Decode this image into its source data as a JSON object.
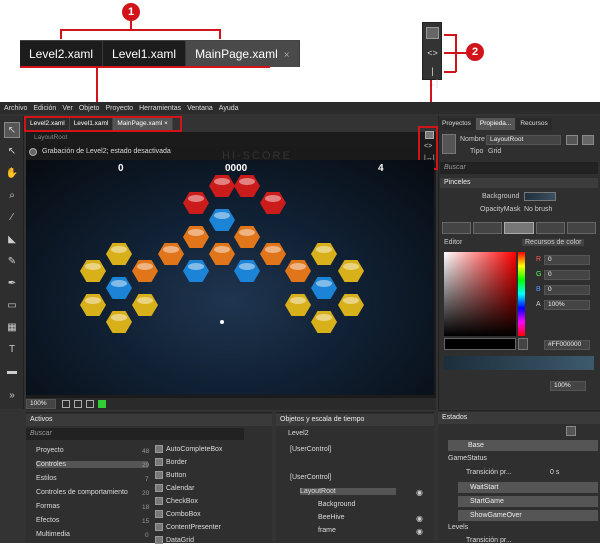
{
  "callout": {
    "tabs": [
      "Level2.xaml",
      "Level1.xaml",
      "MainPage.xaml"
    ],
    "close_glyph": "×",
    "badge1": "1",
    "badge2": "2"
  },
  "menu": [
    "Archivo",
    "Edición",
    "Ver",
    "Objeto",
    "Proyecto",
    "Herramientas",
    "Ventana",
    "Ayuda"
  ],
  "doc_tabs": [
    "Level2.xaml",
    "Level1.xaml",
    "MainPage.xaml"
  ],
  "designer": {
    "breadcrumb": "LayoutRoot",
    "status": "Grabación de Level2; estado desactivada",
    "score_left": "0",
    "score_center": "0000",
    "score_right": "4",
    "hiscore": "HI-SCORE",
    "zoom": "100%"
  },
  "properties": {
    "tabs": [
      "Proyectos",
      "Propieda...",
      "Recursos"
    ],
    "name_label": "Nombre",
    "name_value": "LayoutRoot",
    "type_label": "Tipo",
    "type_value": "Grid",
    "search": "Buscar",
    "brushes": "Pinceles",
    "background": "Background",
    "opacity_mask": "OpacityMask",
    "no_brush": "No brush",
    "editor": "Editor",
    "color_resources": "Recursos de color",
    "r": "R",
    "g": "G",
    "b": "B",
    "a": "A",
    "r_val": "0",
    "g_val": "0",
    "b_val": "0",
    "a_val": "100%",
    "hex": "#FF000000",
    "gradient_pct": "100%"
  },
  "assets": {
    "title": "Activos",
    "search": "Buscar",
    "categories": [
      {
        "label": "Proyecto",
        "count": "48"
      },
      {
        "label": "Controles",
        "count": "29"
      },
      {
        "label": "Estilos",
        "count": "7"
      },
      {
        "label": "Controles de comportamiento",
        "count": "20"
      },
      {
        "label": "Formas",
        "count": "18"
      },
      {
        "label": "Efectos",
        "count": "15"
      },
      {
        "label": "Multimedia",
        "count": "0"
      }
    ],
    "controls": [
      "AutoCompleteBox",
      "Border",
      "Button",
      "Calendar",
      "CheckBox",
      "ComboBox",
      "ContentPresenter",
      "DataGrid"
    ]
  },
  "objects": {
    "title": "Objetos y escala de tiempo",
    "level": "Level2",
    "usercontrol_brackets": "[UserControl]",
    "usercontrol": "[UserControl]",
    "layoutroot": "LayoutRoot",
    "children": [
      "Background",
      "BeeHive",
      "frame"
    ]
  },
  "states": {
    "title": "Estados",
    "base": "Base",
    "group1": "GameStatus",
    "transition": "Transición pr...",
    "transition_time": "0 s",
    "items": [
      "WaitStart",
      "StartGame",
      "ShowGameOver"
    ],
    "group2": "Levels",
    "transition2": "Transición pr..."
  }
}
